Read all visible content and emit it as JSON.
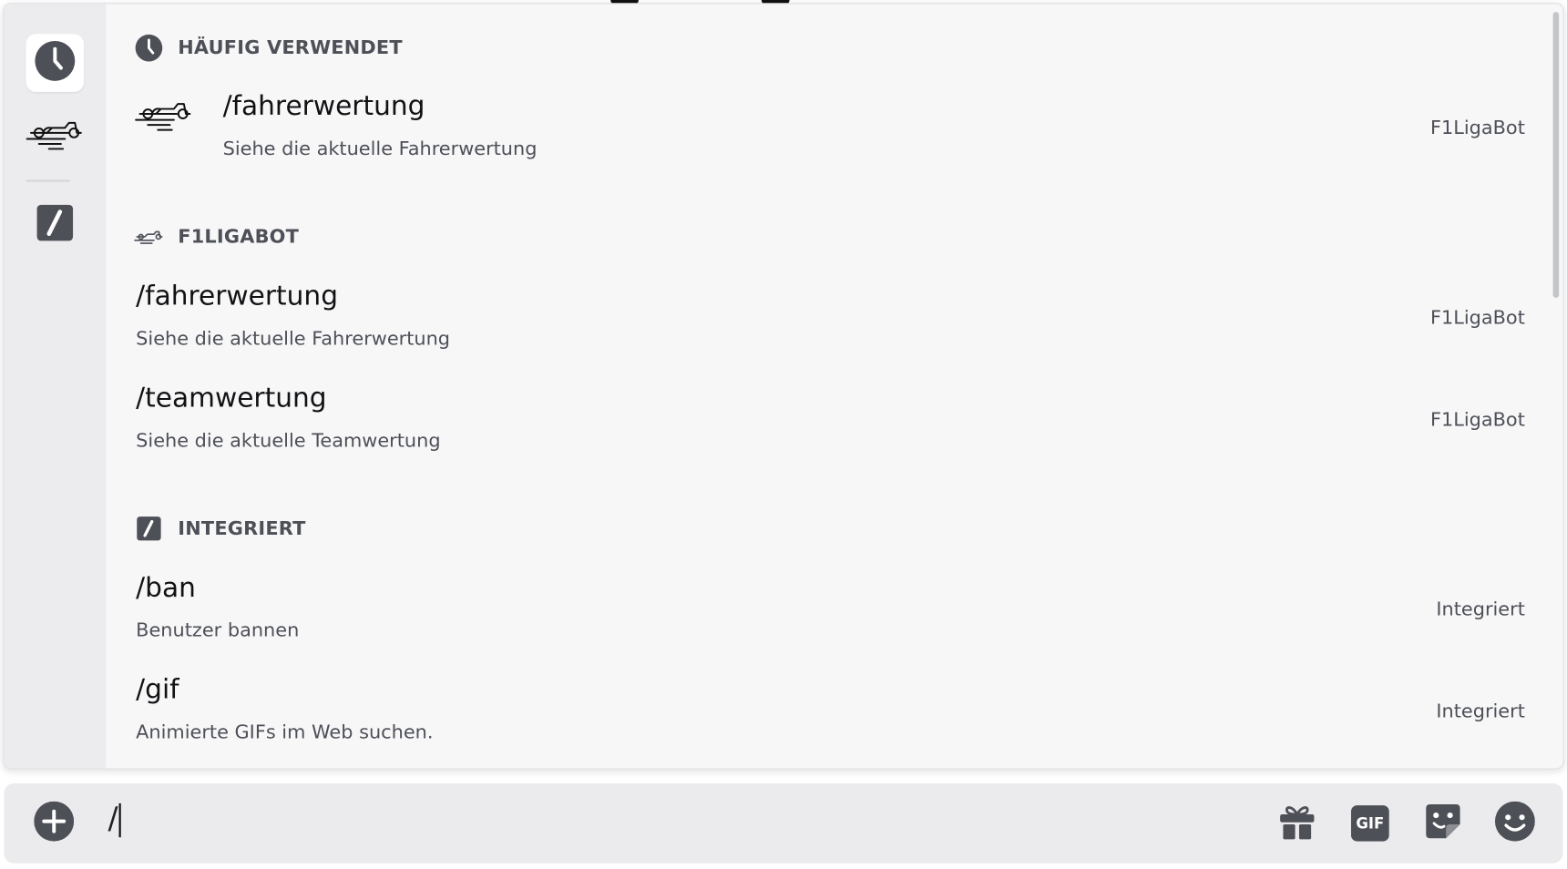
{
  "sections": {
    "frequent": {
      "title": "HÄUFIG VERWENDET",
      "icon": "clock-icon"
    },
    "bot": {
      "title": "F1LIGABOT",
      "icon": "race-car-icon"
    },
    "builtin": {
      "title": "INTEGRIERT",
      "icon": "slash-command-icon"
    }
  },
  "frequent_commands": [
    {
      "name": "/fahrerwertung",
      "description": "Siehe die aktuelle Fahrerwertung",
      "source": "F1LigaBot"
    }
  ],
  "bot_commands": [
    {
      "name": "/fahrerwertung",
      "description": "Siehe die aktuelle Fahrerwertung",
      "source": "F1LigaBot"
    },
    {
      "name": "/teamwertung",
      "description": "Siehe die aktuelle Teamwertung",
      "source": "F1LigaBot"
    }
  ],
  "builtin_commands": [
    {
      "name": "/ban",
      "description": "Benutzer bannen",
      "source": "Integriert"
    },
    {
      "name": "/gif",
      "description": "Animierte GIFs im Web suchen.",
      "source": "Integriert"
    }
  ],
  "rail": [
    {
      "name": "rail-frequent",
      "icon": "clock-icon",
      "active": true
    },
    {
      "name": "rail-f1ligabot",
      "icon": "race-car-icon",
      "active": false
    },
    {
      "name": "rail-builtin",
      "icon": "slash-command-icon",
      "active": false
    }
  ],
  "chatbar": {
    "text": "/",
    "gif_label": "GIF",
    "icons": [
      "add-icon",
      "gift-icon",
      "gif-icon",
      "sticker-icon",
      "emoji-icon"
    ]
  }
}
